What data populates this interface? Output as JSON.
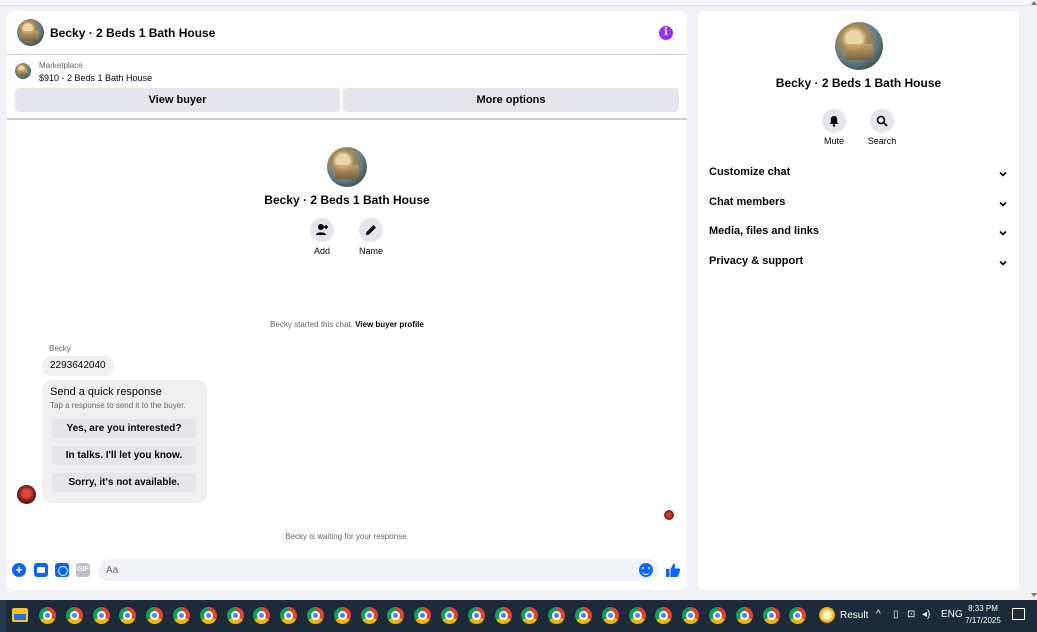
{
  "chat": {
    "header_title": "Becky · 2 Beds 1 Bath House",
    "info_icon": "i",
    "marketplace_label": "Marketplace",
    "listing": "$910 - 2 Beds 1 Bath House",
    "view_buyer": "View buyer",
    "more_options": "More options",
    "center_title": "Becky · 2 Beds 1 Bath House",
    "add_label": "Add",
    "name_label": "Name",
    "started_text": "Becky started this chat.",
    "view_profile": "View buyer profile",
    "sender": "Becky",
    "message": "2293642040",
    "quick_title": "Send a quick response",
    "quick_sub": "Tap a response to send it to the buyer.",
    "quick_responses": [
      "Yes, are you interested?",
      "In talks. I'll let you know.",
      "Sorry, it's not available."
    ],
    "waiting": "Becky is waiting for your response.",
    "composer_placeholder": "Aa",
    "gif_label": "GIF",
    "plus_label": "+"
  },
  "info_panel": {
    "title": "Becky · 2 Beds 1 Bath House",
    "mute": "Mute",
    "search": "Search",
    "sections": [
      "Customize chat",
      "Chat members",
      "Media, files and links",
      "Privacy & support"
    ]
  },
  "taskbar": {
    "result_label": "Result",
    "lang": "ENG",
    "time": "8:33 PM",
    "date": "7/17/2025",
    "chrome_count": 29
  },
  "colors": {
    "accent": "#0866ff",
    "info": "#9b2ff5",
    "taskbar": "#1c2a39"
  }
}
